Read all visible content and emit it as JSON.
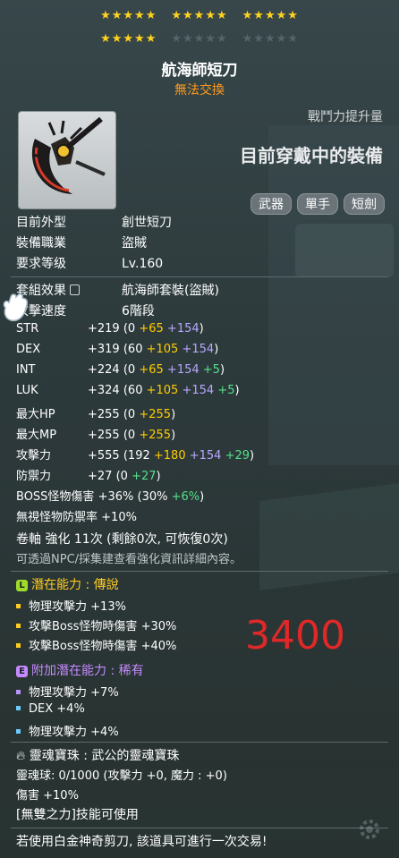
{
  "stars": {
    "row1": [
      "★★★★★",
      "★★★★★",
      "★★★★★"
    ],
    "row2": [
      "★★★★★",
      "★★★★★",
      "★★★★★"
    ]
  },
  "item": {
    "name": "航海師短刀",
    "trade_status": "無法交換",
    "power_label": "戰鬥力提升量",
    "equipped_text": "目前穿戴中的裝備",
    "tags": [
      "武器",
      "單手",
      "短劍"
    ]
  },
  "info": [
    {
      "label": "目前外型",
      "value": "創世短刀"
    },
    {
      "label": "裝備職業",
      "value": "盜賊"
    },
    {
      "label": "要求等级",
      "value": "Lv.160"
    }
  ],
  "set": {
    "label": "套組效果",
    "value": "航海師套裝(盜賊)"
  },
  "speed": {
    "label": "攻擊速度",
    "value": "6階段"
  },
  "stats": [
    {
      "name": "STR",
      "total": "+219",
      "open": "(0",
      "y": "+65",
      "p": "+154",
      "g": "",
      "close": ")"
    },
    {
      "name": "DEX",
      "total": "+319",
      "open": "(60",
      "y": "+105",
      "p": "+154",
      "g": "",
      "close": ")"
    },
    {
      "name": "INT",
      "total": "+224",
      "open": "(0",
      "y": "+65",
      "p": "+154",
      "g": "+5",
      "close": ")"
    },
    {
      "name": "LUK",
      "total": "+324",
      "open": "(60",
      "y": "+105",
      "p": "+154",
      "g": "+5",
      "close": ")"
    },
    {
      "name": "最大HP",
      "total": "+255",
      "open": "(0",
      "y": "+255",
      "p": "",
      "g": "",
      "close": ")"
    },
    {
      "name": "最大MP",
      "total": "+255",
      "open": "(0",
      "y": "+255",
      "p": "",
      "g": "",
      "close": ")"
    },
    {
      "name": "攻擊力",
      "total": "+555",
      "open": "(192",
      "y": "+180",
      "p": "+154",
      "g": "+29",
      "close": ")"
    },
    {
      "name": "防禦力",
      "total": "+27",
      "open": "(0",
      "y": "",
      "p": "",
      "g": "+27",
      "close": ")"
    }
  ],
  "boss": {
    "label": "BOSS怪物傷害",
    "value": "+36%",
    "open": "(30%",
    "g": "+6%",
    "close": ")"
  },
  "ignore": {
    "label": "無視怪物防禦率",
    "value": "+10%"
  },
  "scroll": {
    "text": "卷軸 強化 11次 (剩餘0次, 可恢復0次)",
    "hint": "可透過NPC/採集建查看強化資訊詳細內容。"
  },
  "potential": {
    "badge": "L",
    "label": "潛在能力",
    "sep": ":",
    "grade": "傳說",
    "lines": [
      {
        "name": "物理攻擊力",
        "value": "+13%"
      },
      {
        "name": "攻擊Boss怪物時傷害",
        "value": "+30%"
      },
      {
        "name": "攻擊Boss怪物時傷害",
        "value": "+40%"
      }
    ]
  },
  "additional": {
    "badge": "E",
    "label": "附加潛在能力",
    "sep": ":",
    "grade": "稀有",
    "lines": [
      {
        "name": "物理攻擊力",
        "value": "+7%"
      },
      {
        "name": "DEX",
        "value": "+4%"
      },
      {
        "name": "物理攻擊力",
        "value": "+4%"
      }
    ]
  },
  "soul": {
    "label": "靈魂寶珠",
    "sep": ":",
    "name": "武公的靈魂寶珠",
    "orb_line": "靈魂球: 0/1000 (攻擊力 +0, 魔力 : +0)",
    "damage_line": "傷害 +10%",
    "skill_line": "[無雙之力]技能可使用"
  },
  "footer": "若使用白金神奇剪刀, 該道具可進行一次交易!",
  "overlay_number": "3400",
  "colors": {
    "legendary": "#ffcc22",
    "epic_potential": "#c58aff",
    "overlay": "#e02828"
  }
}
